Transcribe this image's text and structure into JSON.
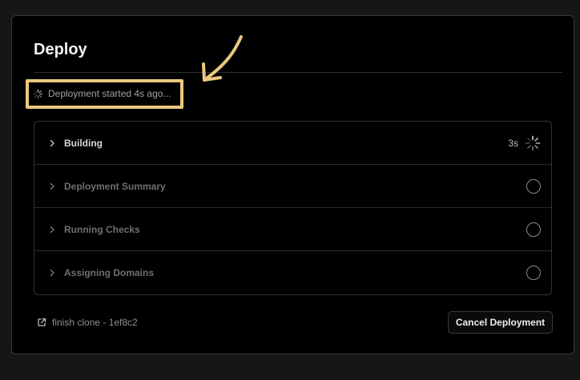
{
  "panel": {
    "title": "Deploy",
    "status_text": "Deployment started 4s ago...",
    "status_icon": "loading-spinner-icon",
    "annotation_color": "#ecc87f"
  },
  "steps": [
    {
      "label": "Building",
      "duration": "3s",
      "state": "in-progress"
    },
    {
      "label": "Deployment Summary",
      "duration": "",
      "state": "pending"
    },
    {
      "label": "Running Checks",
      "duration": "",
      "state": "pending"
    },
    {
      "label": "Assigning Domains",
      "duration": "",
      "state": "pending"
    }
  ],
  "footer": {
    "link_text": "finish clone - 1ef8c2",
    "link_icon": "external-link-icon",
    "cancel_label": "Cancel Deployment"
  }
}
